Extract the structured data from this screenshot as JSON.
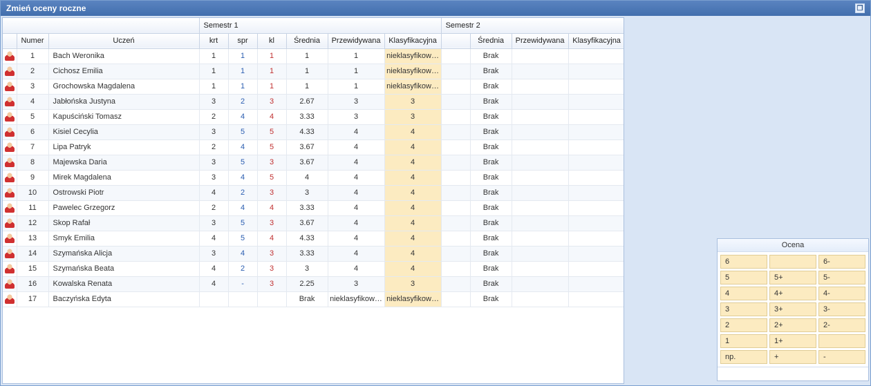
{
  "window": {
    "title": "Zmień oceny roczne"
  },
  "semesters": {
    "s1": "Semestr 1",
    "s2": "Semestr 2"
  },
  "columns": {
    "numer": "Numer",
    "uczen": "Uczeń",
    "krt": "krt",
    "spr": "spr",
    "kl": "kl",
    "srednia": "Średnia",
    "przewidywana": "Przewidywana",
    "klasyfikacyjna": "Klasyfikacyjna"
  },
  "rows": [
    {
      "num": "1",
      "name": "Bach Weronika",
      "krt": "1",
      "spr": "1",
      "kl": "1",
      "avg": "1",
      "pred": "1",
      "klas": "nieklasyfikow…",
      "s2avg": "Brak"
    },
    {
      "num": "2",
      "name": "Cichosz Emilia",
      "krt": "1",
      "spr": "1",
      "kl": "1",
      "avg": "1",
      "pred": "1",
      "klas": "nieklasyfikow…",
      "s2avg": "Brak"
    },
    {
      "num": "3",
      "name": "Grochowska Magdalena",
      "krt": "1",
      "spr": "1",
      "kl": "1",
      "avg": "1",
      "pred": "1",
      "klas": "nieklasyfikow…",
      "s2avg": "Brak"
    },
    {
      "num": "4",
      "name": "Jabłońska Justyna",
      "krt": "3",
      "spr": "2",
      "kl": "3",
      "avg": "2.67",
      "pred": "3",
      "klas": "3",
      "s2avg": "Brak"
    },
    {
      "num": "5",
      "name": "Kapuściński Tomasz",
      "krt": "2",
      "spr": "4",
      "kl": "4",
      "avg": "3.33",
      "pred": "3",
      "klas": "3",
      "s2avg": "Brak"
    },
    {
      "num": "6",
      "name": "Kisiel Cecylia",
      "krt": "3",
      "spr": "5",
      "kl": "5",
      "avg": "4.33",
      "pred": "4",
      "klas": "4",
      "s2avg": "Brak"
    },
    {
      "num": "7",
      "name": "Lipa Patryk",
      "krt": "2",
      "spr": "4",
      "kl": "5",
      "avg": "3.67",
      "pred": "4",
      "klas": "4",
      "s2avg": "Brak"
    },
    {
      "num": "8",
      "name": "Majewska Daria",
      "krt": "3",
      "spr": "5",
      "kl": "3",
      "avg": "3.67",
      "pred": "4",
      "klas": "4",
      "s2avg": "Brak"
    },
    {
      "num": "9",
      "name": "Mirek Magdalena",
      "krt": "3",
      "spr": "4",
      "kl": "5",
      "avg": "4",
      "pred": "4",
      "klas": "4",
      "s2avg": "Brak"
    },
    {
      "num": "10",
      "name": "Ostrowski Piotr",
      "krt": "4",
      "spr": "2",
      "kl": "3",
      "avg": "3",
      "pred": "4",
      "klas": "4",
      "s2avg": "Brak"
    },
    {
      "num": "11",
      "name": "Pawelec Grzegorz",
      "krt": "2",
      "spr": "4",
      "kl": "4",
      "avg": "3.33",
      "pred": "4",
      "klas": "4",
      "s2avg": "Brak"
    },
    {
      "num": "12",
      "name": "Skop Rafał",
      "krt": "3",
      "spr": "5",
      "kl": "3",
      "avg": "3.67",
      "pred": "4",
      "klas": "4",
      "s2avg": "Brak"
    },
    {
      "num": "13",
      "name": "Smyk Emilia",
      "krt": "4",
      "spr": "5",
      "kl": "4",
      "avg": "4.33",
      "pred": "4",
      "klas": "4",
      "s2avg": "Brak"
    },
    {
      "num": "14",
      "name": "Szymańska Alicja",
      "krt": "3",
      "spr": "4",
      "kl": "3",
      "avg": "3.33",
      "pred": "4",
      "klas": "4",
      "s2avg": "Brak"
    },
    {
      "num": "15",
      "name": "Szymańska Beata",
      "krt": "4",
      "spr": "2",
      "kl": "3",
      "avg": "3",
      "pred": "4",
      "klas": "4",
      "s2avg": "Brak"
    },
    {
      "num": "16",
      "name": "Kowalska Renata",
      "krt": "4",
      "spr": "-",
      "kl": "3",
      "avg": "2.25",
      "pred": "3",
      "klas": "3",
      "s2avg": "Brak"
    },
    {
      "num": "17",
      "name": "Baczyńska Edyta",
      "krt": "",
      "spr": "",
      "kl": "",
      "avg": "Brak",
      "pred": "nieklasyfikow…",
      "klas": "nieklasyfikow…",
      "s2avg": "Brak"
    }
  ],
  "gradePanel": {
    "title": "Ocena",
    "buttons": [
      [
        "6",
        "",
        "6-"
      ],
      [
        "5",
        "5+",
        "5-"
      ],
      [
        "4",
        "4+",
        "4-"
      ],
      [
        "3",
        "3+",
        "3-"
      ],
      [
        "2",
        "2+",
        "2-"
      ],
      [
        "1",
        "1+",
        ""
      ],
      [
        "np.",
        "+",
        "-"
      ]
    ]
  }
}
